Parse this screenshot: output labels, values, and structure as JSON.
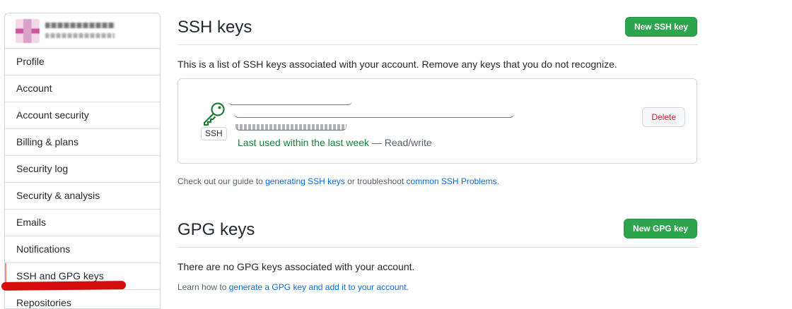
{
  "sidebar": {
    "items": [
      {
        "label": "Profile"
      },
      {
        "label": "Account"
      },
      {
        "label": "Account security"
      },
      {
        "label": "Billing & plans"
      },
      {
        "label": "Security log"
      },
      {
        "label": "Security & analysis"
      },
      {
        "label": "Emails"
      },
      {
        "label": "Notifications"
      },
      {
        "label": "SSH and GPG keys",
        "selected": true
      },
      {
        "label": "Repositories"
      }
    ]
  },
  "ssh": {
    "title": "SSH keys",
    "new_button": "New SSH key",
    "description": "This is a list of SSH keys associated with your account. Remove any keys that you do not recognize.",
    "key": {
      "type_badge": "SSH",
      "last_used": "Last used within the last week",
      "access": " — Read/write",
      "delete_label": "Delete"
    },
    "guide": {
      "prefix": "Check out our guide to ",
      "link1": "generating SSH keys",
      "middle": " or troubleshoot ",
      "link2": "common SSH Problems",
      "suffix": "."
    }
  },
  "gpg": {
    "title": "GPG keys",
    "new_button": "New GPG key",
    "description": "There are no GPG keys associated with your account.",
    "learn": {
      "prefix": "Learn how to ",
      "link": "generate a GPG key and add it to your account",
      "suffix": "."
    }
  },
  "colors": {
    "primary_button": "#2da44e",
    "link": "#0969da",
    "success_text": "#1a7f37",
    "danger_text": "#cf222e",
    "selected_indicator": "#fd8c73",
    "annotation": "#d40c0c"
  }
}
